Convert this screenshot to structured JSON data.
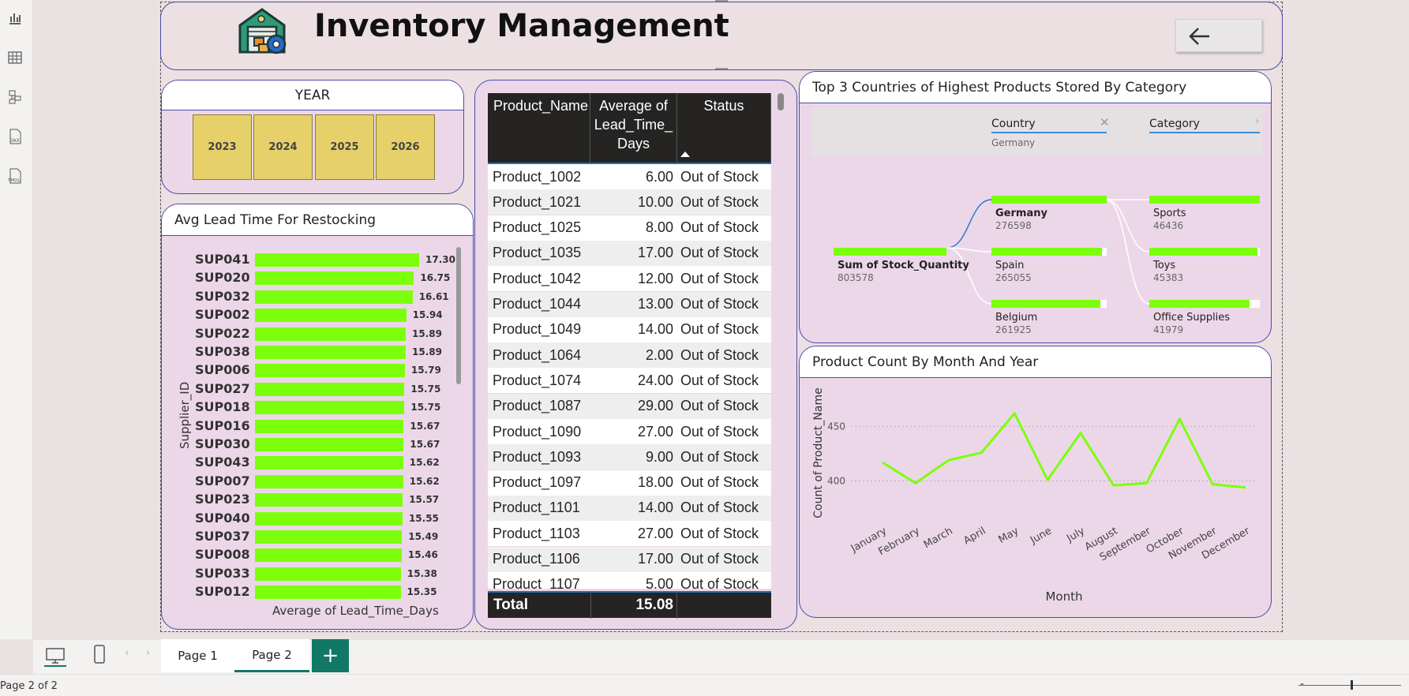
{
  "header": {
    "title": "Inventory Management"
  },
  "status_bar": {
    "page_info": "Page 2 of 2"
  },
  "tabs": [
    {
      "label": "Page 1"
    },
    {
      "label": "Page 2"
    }
  ],
  "year_slicer": {
    "title": "YEAR",
    "years": [
      "2023",
      "2024",
      "2025",
      "2026"
    ]
  },
  "lead_time_chart": {
    "title": "Avg Lead Time For Restocking",
    "ylabel": "Supplier_ID",
    "xlabel": "Average of Lead_Time_Days"
  },
  "table": {
    "columns": [
      "Product_Name",
      "Average of Lead_Time_ Days",
      "Status"
    ],
    "rows": [
      [
        "Product_1002",
        "6.00",
        "Out of Stock"
      ],
      [
        "Product_1021",
        "10.00",
        "Out of Stock"
      ],
      [
        "Product_1025",
        "8.00",
        "Out of Stock"
      ],
      [
        "Product_1035",
        "17.00",
        "Out of Stock"
      ],
      [
        "Product_1042",
        "12.00",
        "Out of Stock"
      ],
      [
        "Product_1044",
        "13.00",
        "Out of Stock"
      ],
      [
        "Product_1049",
        "14.00",
        "Out of Stock"
      ],
      [
        "Product_1064",
        "2.00",
        "Out of Stock"
      ],
      [
        "Product_1074",
        "24.00",
        "Out of Stock"
      ],
      [
        "Product_1087",
        "29.00",
        "Out of Stock"
      ],
      [
        "Product_1090",
        "27.00",
        "Out of Stock"
      ],
      [
        "Product_1093",
        "9.00",
        "Out of Stock"
      ],
      [
        "Product_1097",
        "18.00",
        "Out of Stock"
      ],
      [
        "Product_1101",
        "14.00",
        "Out of Stock"
      ],
      [
        "Product_1103",
        "27.00",
        "Out of Stock"
      ],
      [
        "Product_1106",
        "17.00",
        "Out of Stock"
      ],
      [
        "Product_1107",
        "5.00",
        "Out of Stock"
      ]
    ],
    "total_label": "Total",
    "total_value": "15.08"
  },
  "decomp_tree": {
    "title": "Top 3 Countries of Highest Products Stored By Category",
    "level1_header": "Country",
    "level1_filter": "Germany",
    "level2_header": "Category",
    "root": {
      "label": "Sum of Stock_Quantity",
      "value": "803578"
    },
    "countries": [
      {
        "label": "Germany",
        "value": "276598",
        "fraction": 1.0
      },
      {
        "label": "Spain",
        "value": "265055",
        "fraction": 0.958
      },
      {
        "label": "Belgium",
        "value": "261925",
        "fraction": 0.947
      }
    ],
    "categories": [
      {
        "label": "Sports",
        "value": "46436",
        "fraction": 1.0
      },
      {
        "label": "Toys",
        "value": "45383",
        "fraction": 0.977
      },
      {
        "label": "Office Supplies",
        "value": "41979",
        "fraction": 0.904
      }
    ]
  },
  "line_chart_card": {
    "title": "Product Count By Month And Year"
  },
  "colors": {
    "bar": "#7cff0c",
    "card": "#ecd7e8",
    "border": "#4a4aa8",
    "slicer": "#e6d06a"
  },
  "chart_data": [
    {
      "type": "bar",
      "orientation": "horizontal",
      "title": "Avg Lead Time For Restocking",
      "xlabel": "Average of Lead_Time_Days",
      "ylabel": "Supplier_ID",
      "categories": [
        "SUP041",
        "SUP020",
        "SUP032",
        "SUP002",
        "SUP022",
        "SUP038",
        "SUP006",
        "SUP027",
        "SUP018",
        "SUP016",
        "SUP030",
        "SUP043",
        "SUP007",
        "SUP023",
        "SUP040",
        "SUP037",
        "SUP008",
        "SUP033",
        "SUP012"
      ],
      "values": [
        17.3,
        16.75,
        16.61,
        15.94,
        15.89,
        15.89,
        15.79,
        15.75,
        15.75,
        15.67,
        15.67,
        15.62,
        15.62,
        15.57,
        15.55,
        15.49,
        15.46,
        15.38,
        15.35
      ],
      "data_labels": [
        "17.30",
        "16.75",
        "16.61",
        "15.94",
        "15.89",
        "15.89",
        "15.79",
        "15.75",
        "15.75",
        "15.67",
        "15.67",
        "15.62",
        "15.62",
        "15.57",
        "15.55",
        "15.49",
        "15.46",
        "15.38",
        "15.35"
      ]
    },
    {
      "type": "line",
      "title": "Product Count By Month And Year",
      "xlabel": "Month",
      "ylabel": "Count of Product_Name",
      "categories": [
        "January",
        "February",
        "March",
        "April",
        "May",
        "June",
        "July",
        "August",
        "September",
        "October",
        "November",
        "December"
      ],
      "values": [
        417,
        398,
        419,
        426,
        462,
        401,
        444,
        396,
        398,
        457,
        397,
        394
      ],
      "yticks": [
        "400",
        "450"
      ],
      "ytick_values": [
        400,
        450
      ],
      "ylim": [
        375,
        480
      ]
    }
  ]
}
